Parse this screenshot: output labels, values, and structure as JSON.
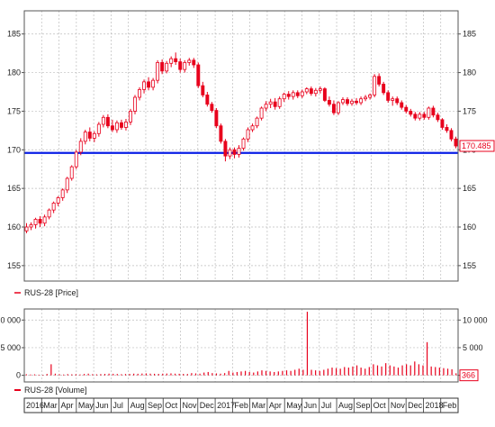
{
  "chart_data": [
    {
      "type": "candlestick",
      "series_name": "RUS-28 [Price]",
      "ylim": [
        153,
        188
      ],
      "yticks": [
        155,
        160,
        165,
        170,
        175,
        180,
        185
      ],
      "grid": true,
      "line_level": 169.6,
      "last_value": "170.485",
      "colors": {
        "up": "#ffffff",
        "down": "#e8001c",
        "outline": "#e8001c",
        "line": "#0a1ee6"
      },
      "ohlc": [
        [
          159.5,
          160.5,
          159.2,
          160.0
        ],
        [
          160.0,
          160.6,
          159.6,
          160.3
        ],
        [
          160.3,
          161.2,
          159.8,
          161.0
        ],
        [
          161.0,
          161.4,
          160.0,
          160.5
        ],
        [
          160.5,
          161.6,
          160.1,
          161.3
        ],
        [
          161.3,
          162.4,
          161.0,
          162.2
        ],
        [
          162.2,
          163.3,
          161.8,
          163.1
        ],
        [
          163.1,
          164.0,
          162.7,
          163.8
        ],
        [
          163.8,
          165.0,
          163.4,
          164.8
        ],
        [
          164.8,
          166.5,
          164.4,
          166.3
        ],
        [
          166.3,
          168.0,
          166.0,
          167.8
        ],
        [
          167.8,
          170.0,
          167.5,
          169.7
        ],
        [
          169.7,
          171.5,
          169.3,
          171.1
        ],
        [
          171.1,
          172.6,
          170.7,
          172.3
        ],
        [
          172.3,
          172.9,
          171.1,
          171.5
        ],
        [
          171.5,
          172.4,
          171.0,
          172.1
        ],
        [
          172.1,
          173.6,
          171.7,
          173.3
        ],
        [
          173.3,
          174.5,
          172.9,
          174.2
        ],
        [
          174.2,
          174.6,
          172.8,
          173.1
        ],
        [
          173.1,
          173.9,
          172.3,
          172.6
        ],
        [
          172.6,
          173.8,
          172.2,
          173.5
        ],
        [
          173.5,
          173.9,
          172.6,
          172.9
        ],
        [
          172.9,
          174.0,
          172.5,
          173.6
        ],
        [
          173.6,
          175.3,
          173.2,
          175.0
        ],
        [
          175.0,
          177.1,
          174.6,
          176.8
        ],
        [
          176.8,
          178.1,
          176.4,
          177.8
        ],
        [
          177.8,
          179.1,
          177.3,
          178.8
        ],
        [
          178.8,
          179.4,
          177.7,
          178.1
        ],
        [
          178.1,
          179.3,
          177.7,
          179.0
        ],
        [
          179.0,
          181.6,
          178.6,
          181.3
        ],
        [
          181.3,
          181.7,
          179.8,
          180.2
        ],
        [
          180.2,
          181.5,
          179.9,
          181.2
        ],
        [
          181.2,
          182.1,
          180.7,
          181.8
        ],
        [
          181.8,
          182.6,
          181.0,
          181.4
        ],
        [
          181.4,
          181.8,
          180.0,
          180.4
        ],
        [
          180.4,
          181.6,
          180.0,
          181.3
        ],
        [
          181.3,
          181.9,
          180.9,
          181.6
        ],
        [
          181.6,
          181.9,
          180.6,
          181.0
        ],
        [
          181.0,
          181.3,
          178.0,
          178.3
        ],
        [
          178.3,
          178.8,
          176.8,
          177.1
        ],
        [
          177.1,
          177.5,
          175.6,
          175.9
        ],
        [
          175.9,
          176.2,
          174.8,
          175.1
        ],
        [
          175.1,
          175.4,
          172.8,
          173.1
        ],
        [
          173.1,
          173.4,
          170.8,
          171.1
        ],
        [
          171.1,
          171.4,
          168.5,
          169.2
        ],
        [
          169.2,
          170.3,
          168.8,
          170.0
        ],
        [
          170.0,
          170.3,
          168.9,
          169.4
        ],
        [
          169.4,
          170.6,
          169.0,
          170.2
        ],
        [
          170.2,
          171.6,
          169.9,
          171.4
        ],
        [
          171.4,
          172.9,
          171.0,
          172.6
        ],
        [
          172.6,
          173.4,
          172.3,
          173.1
        ],
        [
          173.1,
          174.3,
          172.8,
          174.1
        ],
        [
          174.1,
          175.6,
          173.8,
          175.4
        ],
        [
          175.4,
          176.3,
          175.0,
          175.9
        ],
        [
          175.9,
          176.6,
          175.4,
          176.2
        ],
        [
          176.2,
          176.7,
          175.2,
          175.6
        ],
        [
          175.6,
          176.9,
          175.3,
          176.6
        ],
        [
          176.6,
          177.4,
          176.2,
          177.2
        ],
        [
          177.2,
          177.6,
          176.5,
          176.9
        ],
        [
          176.9,
          177.7,
          176.5,
          177.4
        ],
        [
          177.4,
          177.7,
          176.7,
          177.0
        ],
        [
          177.0,
          177.8,
          176.7,
          177.5
        ],
        [
          177.5,
          178.1,
          177.2,
          177.9
        ],
        [
          177.9,
          178.2,
          177.0,
          177.3
        ],
        [
          177.3,
          178.0,
          176.9,
          177.7
        ],
        [
          177.7,
          178.2,
          177.3,
          177.9
        ],
        [
          177.9,
          178.1,
          176.2,
          176.4
        ],
        [
          176.4,
          176.9,
          175.6,
          175.9
        ],
        [
          175.9,
          176.4,
          174.5,
          174.8
        ],
        [
          174.8,
          176.3,
          174.5,
          176.1
        ],
        [
          176.1,
          176.8,
          175.8,
          176.5
        ],
        [
          176.5,
          176.8,
          175.7,
          176.0
        ],
        [
          176.0,
          176.6,
          175.7,
          176.3
        ],
        [
          176.3,
          176.7,
          175.8,
          176.1
        ],
        [
          176.1,
          176.9,
          175.8,
          176.6
        ],
        [
          176.6,
          177.1,
          176.3,
          176.8
        ],
        [
          176.8,
          177.3,
          176.5,
          177.1
        ],
        [
          177.1,
          179.8,
          176.8,
          179.5
        ],
        [
          179.5,
          179.9,
          178.2,
          178.5
        ],
        [
          178.5,
          178.8,
          177.1,
          177.4
        ],
        [
          177.4,
          177.7,
          176.1,
          176.4
        ],
        [
          176.4,
          176.9,
          175.7,
          176.6
        ],
        [
          176.6,
          176.9,
          175.8,
          176.1
        ],
        [
          176.1,
          176.4,
          175.2,
          175.5
        ],
        [
          175.5,
          175.8,
          174.7,
          175.0
        ],
        [
          175.0,
          175.3,
          174.3,
          174.6
        ],
        [
          174.6,
          174.9,
          173.8,
          174.1
        ],
        [
          174.1,
          174.9,
          173.8,
          174.6
        ],
        [
          174.6,
          174.9,
          173.9,
          174.2
        ],
        [
          174.2,
          175.6,
          173.9,
          175.4
        ],
        [
          175.4,
          175.7,
          174.2,
          174.5
        ],
        [
          174.5,
          174.8,
          173.6,
          173.9
        ],
        [
          173.9,
          174.1,
          172.6,
          172.9
        ],
        [
          172.9,
          173.3,
          172.2,
          172.5
        ],
        [
          172.5,
          172.8,
          171.1,
          171.4
        ],
        [
          171.4,
          171.7,
          170.2,
          170.5
        ]
      ]
    },
    {
      "type": "bar",
      "series_name": "RUS-28 [Volume]",
      "ylim": [
        -1200,
        12000
      ],
      "yticks_left": [
        {
          "value": 10000,
          "label": "0 000"
        },
        {
          "value": 5000,
          "label": "5 000"
        },
        {
          "value": 0,
          "label": "0"
        }
      ],
      "yticks_right": [
        {
          "value": 10000,
          "label": "10 000"
        },
        {
          "value": 5000,
          "label": "5 000"
        },
        {
          "value": 0,
          "label": "0"
        }
      ],
      "grid": true,
      "last_value": "366",
      "color": "#e8001c",
      "values": [
        200,
        150,
        180,
        120,
        100,
        250,
        2000,
        300,
        200,
        150,
        220,
        180,
        200,
        160,
        250,
        300,
        200,
        180,
        220,
        260,
        300,
        280,
        250,
        200,
        240,
        260,
        300,
        280,
        320,
        350,
        300,
        280,
        260,
        300,
        320,
        350,
        300,
        280,
        260,
        240,
        400,
        350,
        300,
        500,
        600,
        400,
        350,
        300,
        400,
        800,
        500,
        600,
        700,
        800,
        600,
        500,
        700,
        900,
        800,
        700,
        600,
        700,
        800,
        900,
        800,
        1000,
        1200,
        1000,
        11500,
        1000,
        900,
        800,
        1000,
        1200,
        1400,
        1300,
        1200,
        1500,
        1400,
        1600,
        1800,
        1400,
        1200,
        1500,
        2000,
        1800,
        1600,
        2200,
        1800,
        1600,
        1400,
        1800,
        2000,
        1800,
        2500,
        2000,
        1800,
        6000,
        1600,
        1500,
        1400,
        1300,
        1200,
        1100,
        366
      ]
    }
  ],
  "x_axis_labels": [
    "2016",
    "Mar",
    "Apr",
    "May",
    "Jun",
    "Jul",
    "Aug",
    "Sep",
    "Oct",
    "Nov",
    "Dec",
    "2017",
    "Feb",
    "Mar",
    "Apr",
    "May",
    "Jun",
    "Jul",
    "Aug",
    "Sep",
    "Oct",
    "Nov",
    "Dec",
    "2018",
    "Feb"
  ]
}
